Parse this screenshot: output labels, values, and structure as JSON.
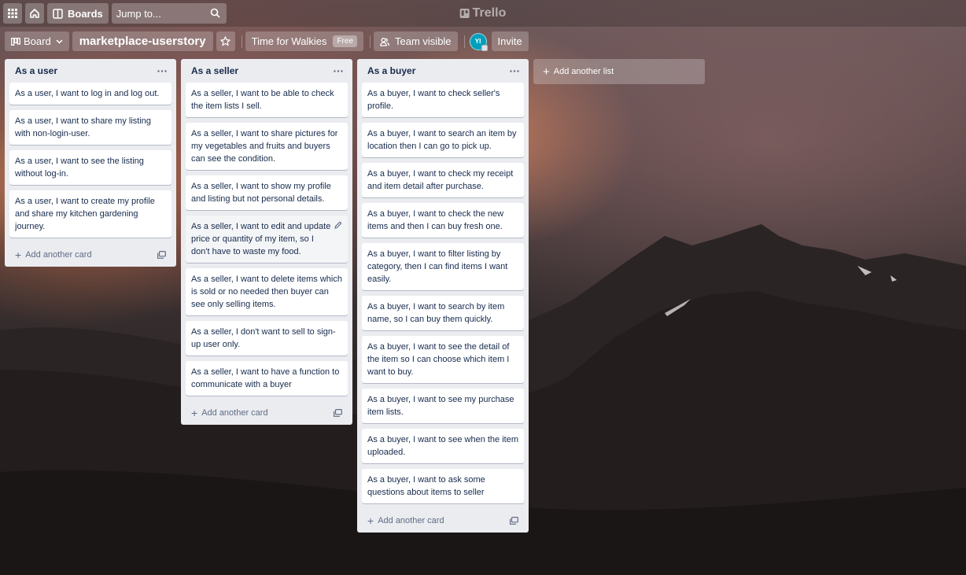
{
  "header": {
    "apps_icon": "grid-icon",
    "home_icon": "home-icon",
    "boards_label": "Boards",
    "search_placeholder": "Jump to...",
    "search_icon": "search-icon",
    "logo_text": "Trello"
  },
  "board": {
    "view_label": "Board",
    "title": "marketplace-userstory",
    "workspace_label": "Time for Walkies",
    "workspace_badge": "Free",
    "visibility_label": "Team visible",
    "avatar_initials": "YI",
    "invite_label": "Invite"
  },
  "lists": [
    {
      "title": "As a user",
      "cards": [
        "As a user, I want to log in and log out.",
        "As a user, I want to share my listing with non-login-user.",
        "As a user, I want to see the listing without log-in.",
        "As a user, I want to create my profile and share my kitchen gardening journey."
      ],
      "add_card_label": "Add another card"
    },
    {
      "title": "As a seller",
      "cards": [
        "As a seller, I want to be able to check the item lists I sell.",
        "As a seller, I want to share pictures for my vegetables and fruits and buyers can see the condition.",
        "As a seller, I want to show my profile and listing but not personal details.",
        "As a seller, I want to edit and update price or quantity of my item, so I don't have to waste my food.",
        "As a seller, I want to delete items which is sold or no needed then buyer can see only selling items.",
        "As a seller, I don't want to sell to sign-up user only.",
        "As a seller, I want to have a function to communicate with a buyer"
      ],
      "add_card_label": "Add another card"
    },
    {
      "title": "As a buyer",
      "cards": [
        "As a buyer, I want to check seller's profile.",
        "As a buyer, I want to search an item by location then I can go to pick up.",
        "As a buyer, I want to check my receipt and item detail after purchase.",
        "As a buyer, I want to check the new items and then I can buy fresh one.",
        "As a buyer, I want to filter listing by category, then I can find items I want easily.",
        "As a buyer, I want to search by item name, so I can buy them quickly.",
        "As a buyer, I want to see the detail of the item so I can choose which item I want to buy.",
        "As a buyer, I want to see my purchase item lists.",
        "As a buyer, I want to see when the item uploaded.",
        "As a buyer, I want to ask some questions about items to seller"
      ],
      "add_card_label": "Add another card"
    }
  ],
  "add_list_label": "Add another list"
}
